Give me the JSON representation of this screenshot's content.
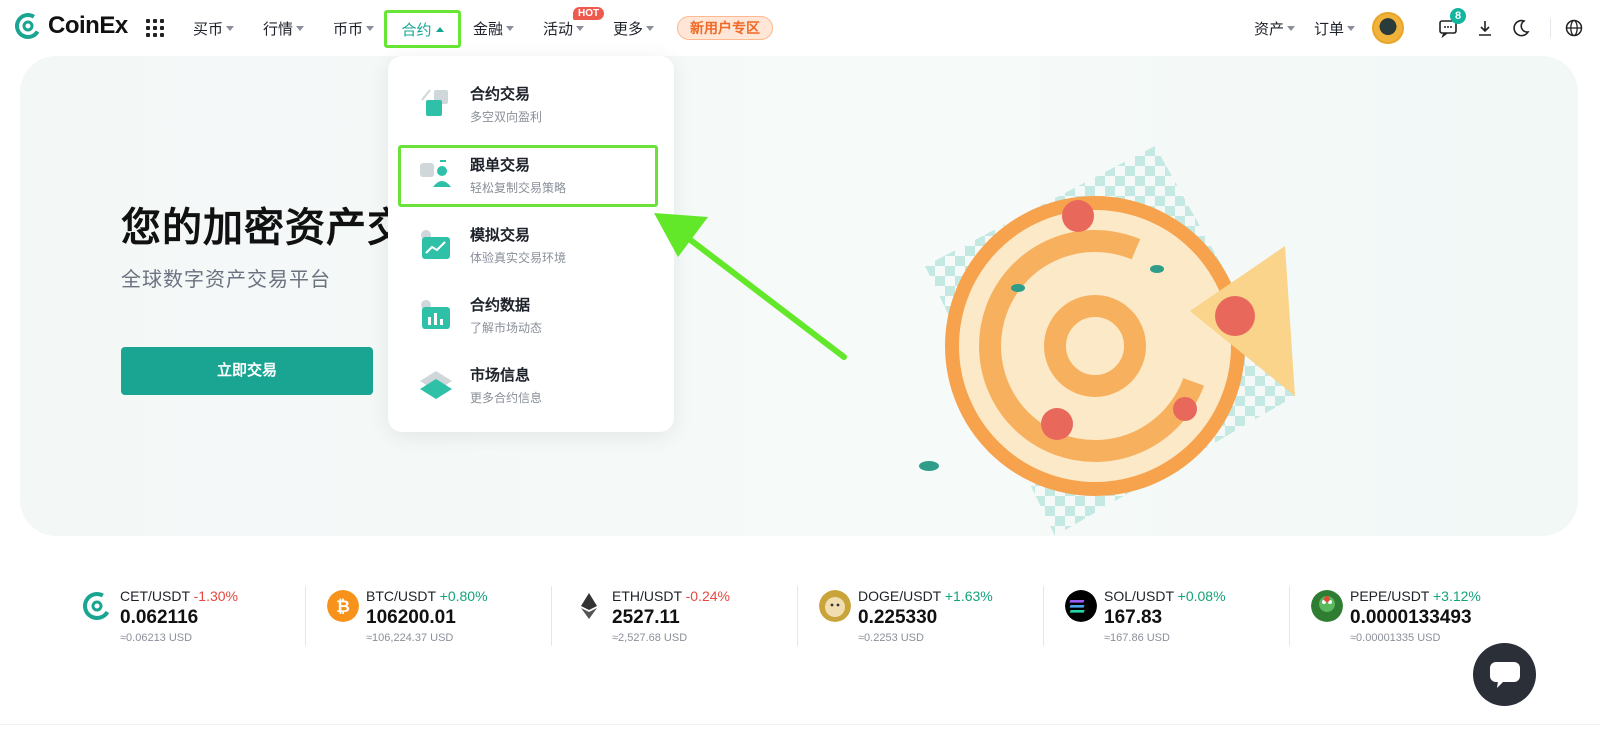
{
  "brand": {
    "name": "CoinEx",
    "accent": "#1aa592"
  },
  "nav": {
    "items": [
      {
        "label": "买币"
      },
      {
        "label": "行情"
      },
      {
        "label": "币币"
      },
      {
        "label": "合约"
      },
      {
        "label": "金融"
      },
      {
        "label": "活动"
      },
      {
        "label": "更多"
      }
    ],
    "hot_badge": "HOT",
    "new_user": "新用户专区",
    "right": [
      {
        "label": "资产"
      },
      {
        "label": "订单"
      }
    ],
    "message_count": "8"
  },
  "hero": {
    "title": "您的加密资产交",
    "subtitle": "全球数字资产交易平台",
    "cta": "立即交易"
  },
  "dropdown": {
    "items": [
      {
        "title": "合约交易",
        "desc": "多空双向盈利"
      },
      {
        "title": "跟单交易",
        "desc": "轻松复制交易策略"
      },
      {
        "title": "模拟交易",
        "desc": "体验真实交易环境"
      },
      {
        "title": "合约数据",
        "desc": "了解市场动态"
      },
      {
        "title": "市场信息",
        "desc": "更多合约信息"
      }
    ]
  },
  "tickers": [
    {
      "pair": "CET/USDT",
      "change": "-1.30%",
      "price": "0.062116",
      "usd": "≈0.06213 USD",
      "dir": "down"
    },
    {
      "pair": "BTC/USDT",
      "change": "+0.80%",
      "price": "106200.01",
      "usd": "≈106,224.37 USD",
      "dir": "up"
    },
    {
      "pair": "ETH/USDT",
      "change": "-0.24%",
      "price": "2527.11",
      "usd": "≈2,527.68 USD",
      "dir": "down"
    },
    {
      "pair": "DOGE/USDT",
      "change": "+1.63%",
      "price": "0.225330",
      "usd": "≈0.2253 USD",
      "dir": "up"
    },
    {
      "pair": "SOL/USDT",
      "change": "+0.08%",
      "price": "167.83",
      "usd": "≈167.86 USD",
      "dir": "up"
    },
    {
      "pair": "PEPE/USDT",
      "change": "+3.12%",
      "price": "0.0000133493",
      "usd": "≈0.00001335 USD",
      "dir": "up"
    }
  ]
}
